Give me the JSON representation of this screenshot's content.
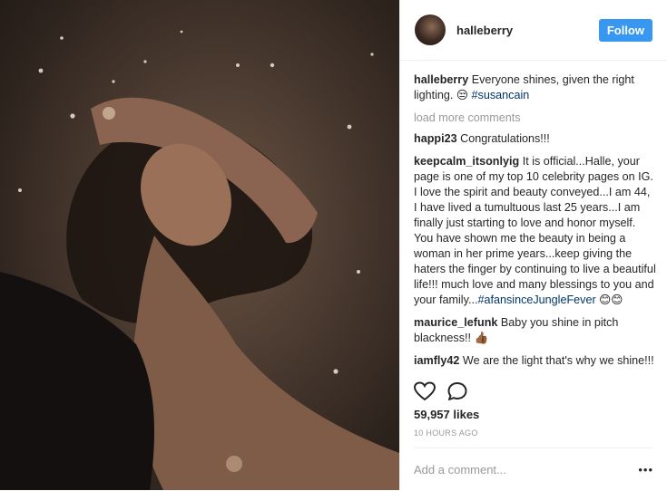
{
  "post": {
    "username": "halleberry",
    "follow_label": "Follow",
    "caption_user": "halleberry",
    "caption_text": "Everyone shines, given the right lighting. 😒",
    "caption_tag": "#susancain",
    "load_more": "load more comments",
    "comments": [
      {
        "user": "happi23",
        "text": "Congratulations!!!",
        "tag": ""
      },
      {
        "user": "keepcalm_itsonlyig",
        "text": "It is official...Halle, your page is one of my top 10 celebrity pages on IG. I love the spirit and beauty conveyed...I am 44, I have lived a tumultuous last 25 years...I am finally just starting to love and honor myself. You have shown me the beauty in being a woman in her prime years...keep giving the haters the finger by continuing to live a beautiful life!!! much love and many blessings to you and your family...",
        "tag": "#afansinceJungleFever",
        "suffix": " 😊😊"
      },
      {
        "user": "maurice_lefunk",
        "text": "Baby you shine in pitch blackness!! 👍🏾",
        "tag": ""
      },
      {
        "user": "iamfly42",
        "text": "We are the light that's why we shine!!!",
        "tag": ""
      }
    ],
    "likes": "59,957 likes",
    "time": "10 HOURS AGO",
    "add_comment_placeholder": "Add a comment...",
    "more_dots": "•••",
    "icons": {
      "like": "heart-icon",
      "comment": "comment-icon"
    },
    "colors": {
      "follow": "#3897f0",
      "hashtag": "#003569",
      "muted": "#999999"
    }
  }
}
